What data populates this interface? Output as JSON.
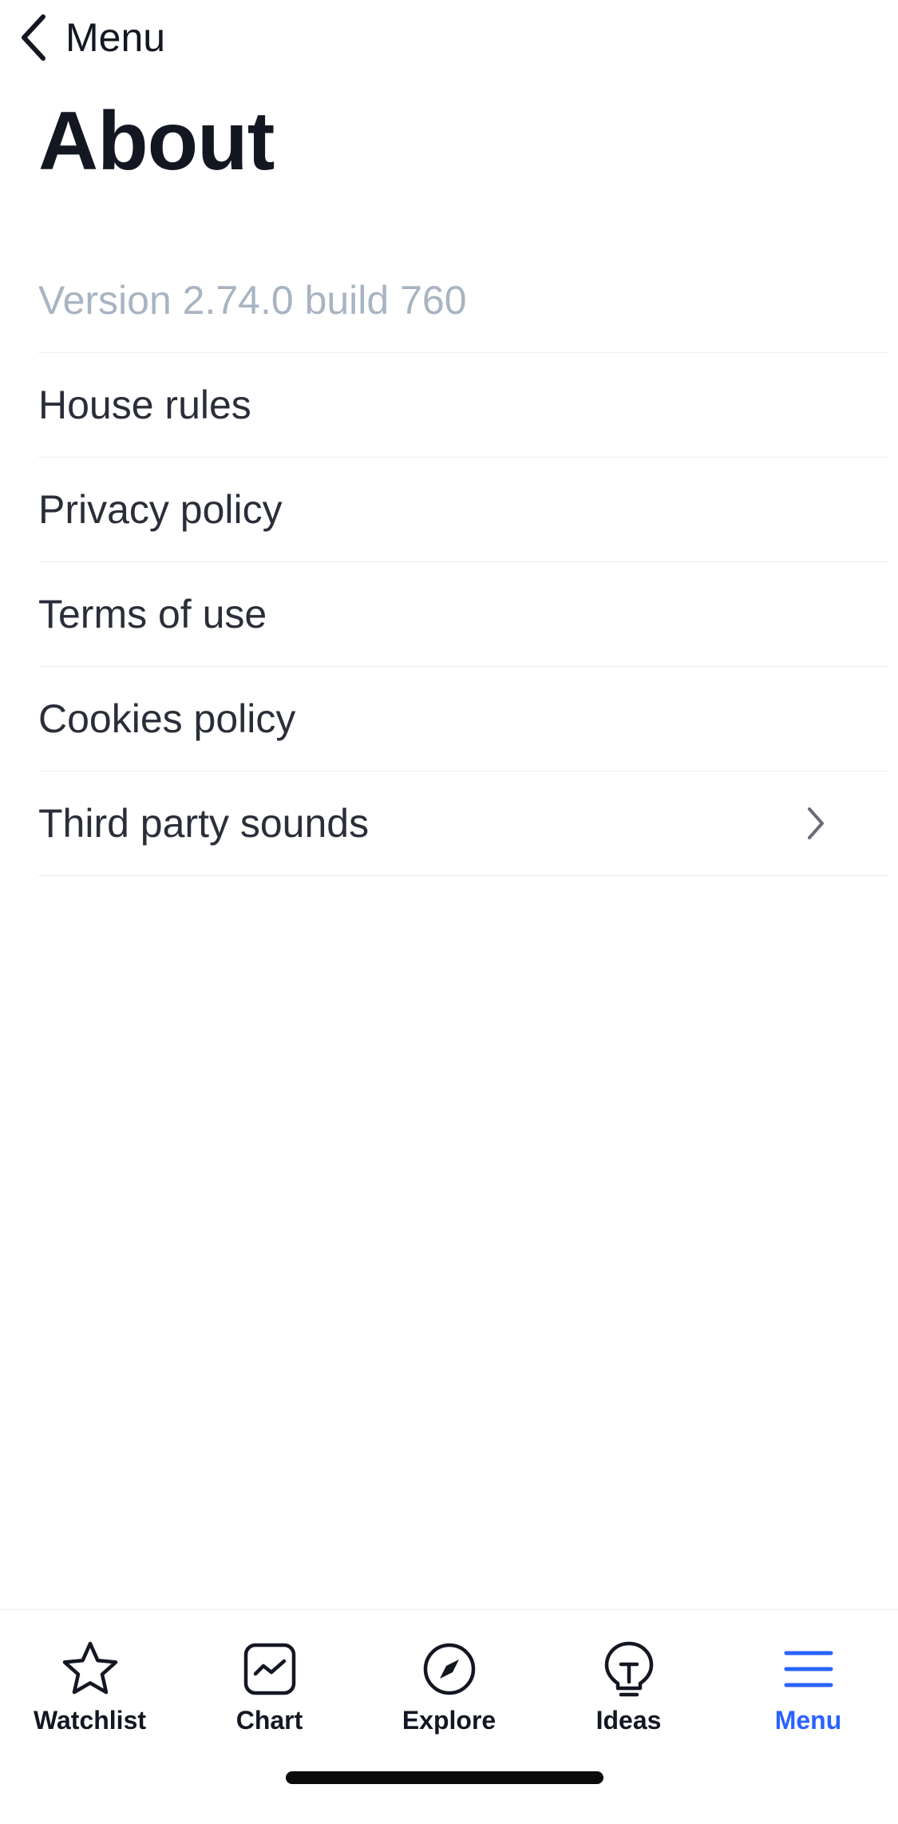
{
  "nav": {
    "back_label": "Menu"
  },
  "page": {
    "title": "About"
  },
  "version": "Version 2.74.0 build 760",
  "items": [
    {
      "label": "House rules",
      "chevron": false
    },
    {
      "label": "Privacy policy",
      "chevron": false
    },
    {
      "label": "Terms of use",
      "chevron": false
    },
    {
      "label": "Cookies policy",
      "chevron": false
    },
    {
      "label": "Third party sounds",
      "chevron": true
    }
  ],
  "tabbar": {
    "tabs": [
      {
        "label": "Watchlist",
        "icon": "star-icon",
        "active": false
      },
      {
        "label": "Chart",
        "icon": "chart-icon",
        "active": false
      },
      {
        "label": "Explore",
        "icon": "compass-icon",
        "active": false
      },
      {
        "label": "Ideas",
        "icon": "lightbulb-icon",
        "active": false
      },
      {
        "label": "Menu",
        "icon": "hamburger-icon",
        "active": true
      }
    ]
  },
  "colors": {
    "accent": "#2962ff",
    "text": "#131722",
    "muted": "#a8b4c2",
    "divider": "#eceef1"
  }
}
